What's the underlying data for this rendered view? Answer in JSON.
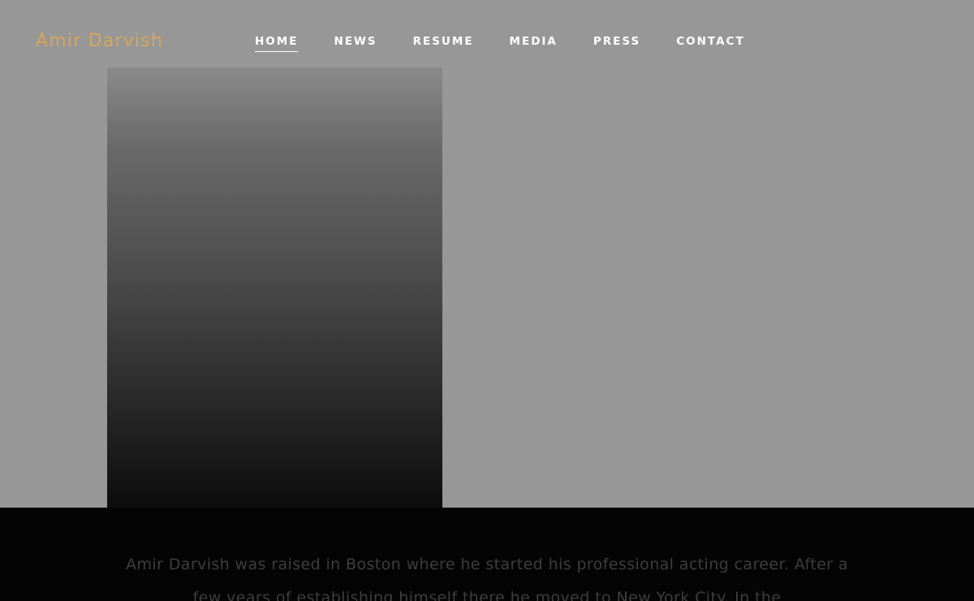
{
  "site": {
    "logo": "Amir Darvish"
  },
  "nav": {
    "items": [
      {
        "label": "HOME",
        "active": true
      },
      {
        "label": "NEWS",
        "active": false
      },
      {
        "label": "RESUME",
        "active": false
      },
      {
        "label": "MEDIA",
        "active": false
      },
      {
        "label": "PRESS",
        "active": false
      },
      {
        "label": "CONTACT",
        "active": false
      }
    ]
  },
  "bio": {
    "text": "Amir Darvish was raised in Boston where he started his professional acting career. After a few years of establishing himself there he moved to New York City. In the"
  },
  "colors": {
    "background": "#979797",
    "logo": "#d9a55a",
    "nav_text": "#ffffff",
    "bio_background": "#040404",
    "bio_text": "#3d3d3d"
  }
}
